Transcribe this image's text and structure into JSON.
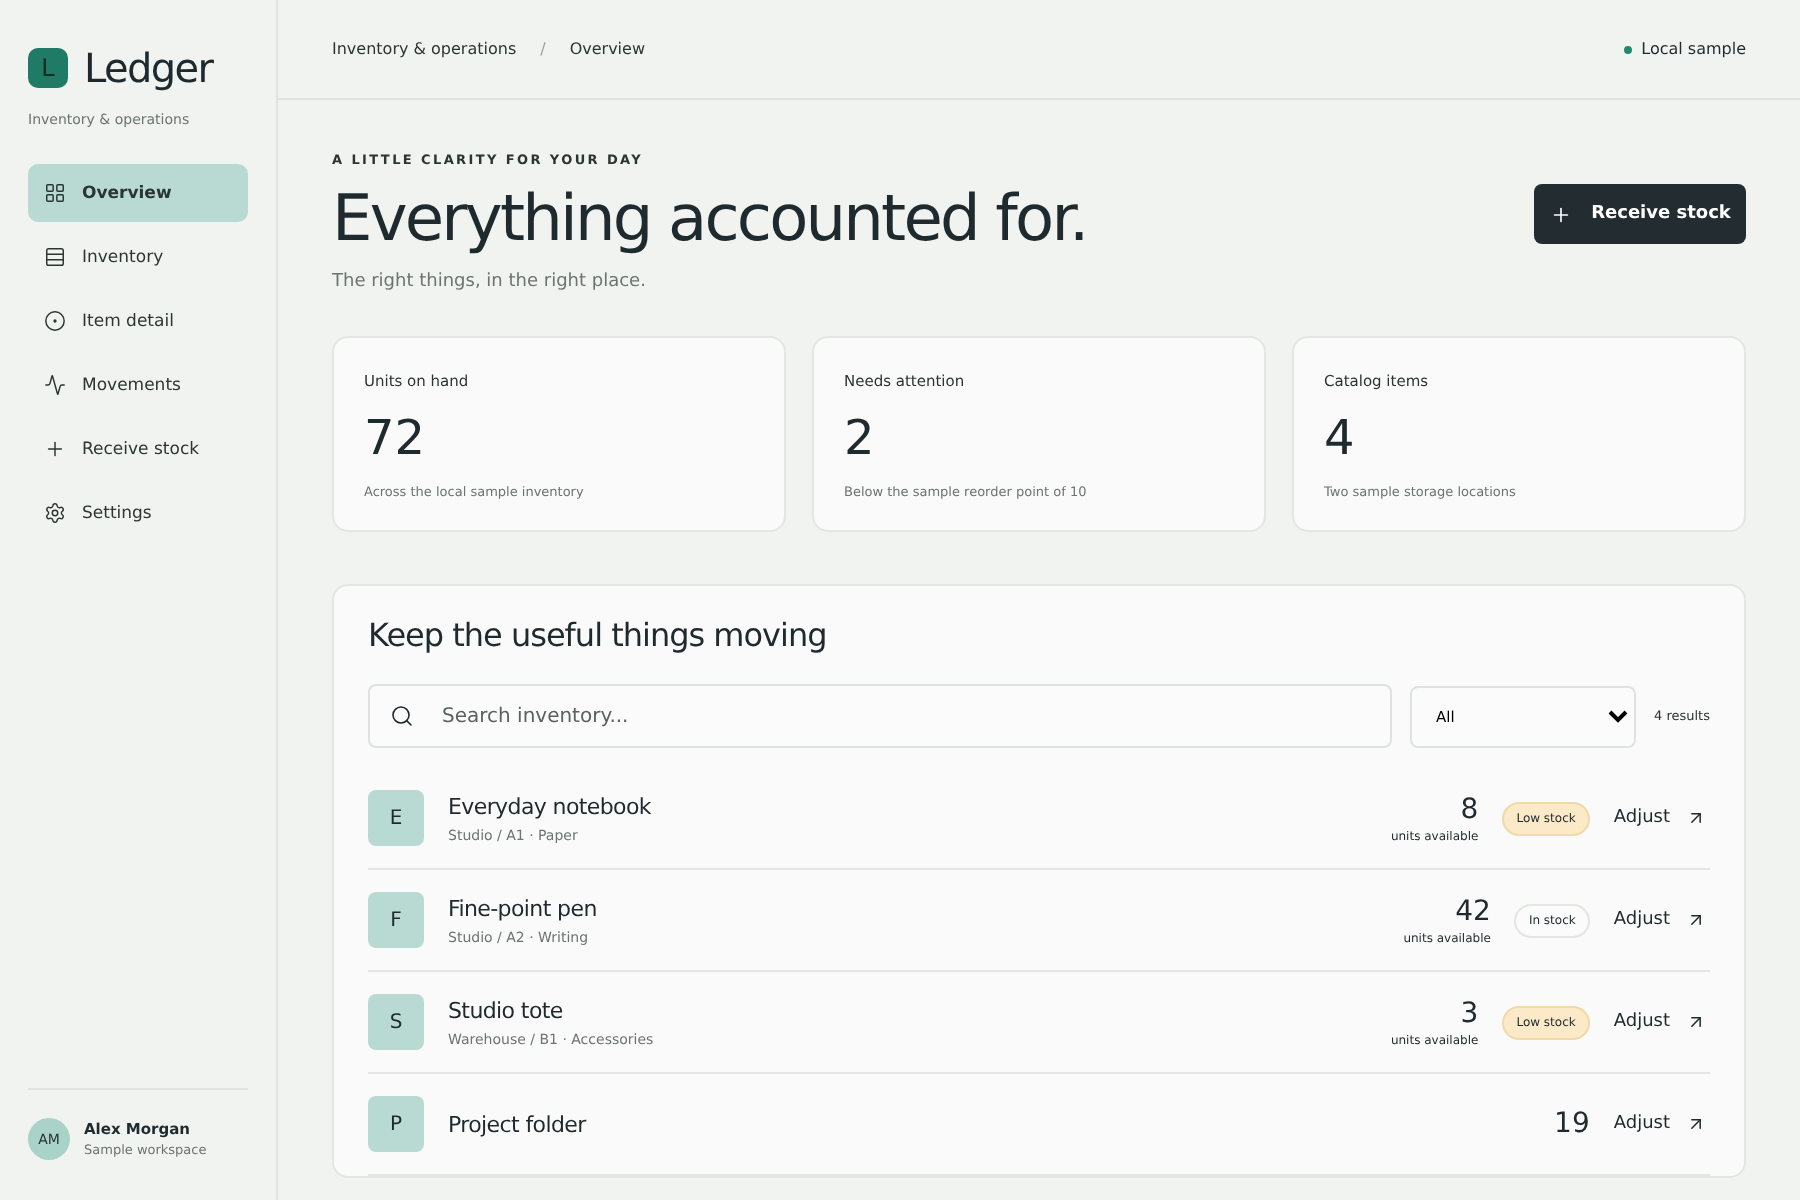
{
  "brand": {
    "logo_letter": "L",
    "name": "Ledger",
    "subtitle": "Inventory & operations"
  },
  "nav": [
    {
      "label": "Overview",
      "selected": true
    },
    {
      "label": "Inventory",
      "selected": false
    },
    {
      "label": "Item detail",
      "selected": false
    },
    {
      "label": "Movements",
      "selected": false
    },
    {
      "label": "Receive stock",
      "selected": false
    },
    {
      "label": "Settings",
      "selected": false
    }
  ],
  "user": {
    "initials": "AM",
    "name": "Alex Morgan",
    "workspace": "Sample workspace"
  },
  "breadcrumb": [
    "Inventory & operations",
    "/",
    "Overview"
  ],
  "status": {
    "label": "Local sample",
    "color": "#1f8a6e"
  },
  "hero": {
    "eyebrow": "A LITTLE CLARITY FOR YOUR DAY",
    "title": "Everything accounted for.",
    "subtitle": "The right things, in the right place.",
    "button": "Receive stock"
  },
  "stats": [
    {
      "label": "Units on hand",
      "value": "72",
      "note": "Across the local sample inventory"
    },
    {
      "label": "Needs attention",
      "value": "2",
      "note": "Below the sample reorder point of 10"
    },
    {
      "label": "Catalog items",
      "value": "4",
      "note": "Two sample storage locations"
    }
  ],
  "panel": {
    "title": "Keep the useful things moving",
    "search_placeholder": "Search inventory...",
    "filter": "All",
    "results": "4 results",
    "items": [
      {
        "letter": "E",
        "name": "Everyday notebook",
        "location": "Studio / A1 · Paper",
        "qty": "8",
        "qty_label": "units available",
        "badge": "Low stock",
        "kind": "low",
        "action": "Adjust"
      },
      {
        "letter": "F",
        "name": "Fine-point pen",
        "location": "Studio / A2 · Writing",
        "qty": "42",
        "qty_label": "units available",
        "badge": "In stock",
        "kind": "ok",
        "action": "Adjust"
      },
      {
        "letter": "S",
        "name": "Studio tote",
        "location": "Warehouse / B1 · Accessories",
        "qty": "3",
        "qty_label": "units available",
        "badge": "Low stock",
        "kind": "low",
        "action": "Adjust"
      },
      {
        "letter": "P",
        "name": "Project folder",
        "qty": "19",
        "action": "Adjust"
      }
    ]
  }
}
